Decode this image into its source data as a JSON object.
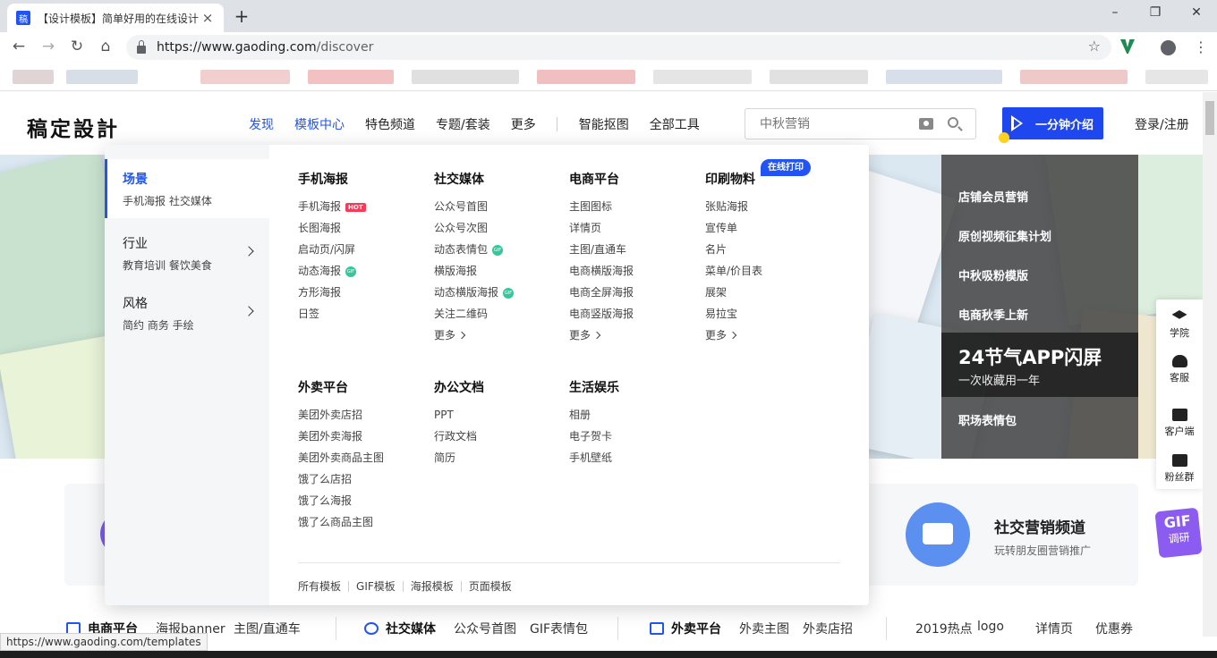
{
  "browser": {
    "tab_title": "【设计模板】简单好用的在线设计",
    "tab_close": "×",
    "new_tab": "+",
    "url_host": "https://www.gaoding.com",
    "url_path": "/discover",
    "favicon_text": "稿",
    "window_controls": [
      "–",
      "❐",
      "✕"
    ],
    "nav_icons": [
      "←",
      "→",
      "↻",
      "⌂"
    ],
    "star_icon": "☆",
    "menu_icon": "⋮"
  },
  "header": {
    "logo": "稿定設計",
    "nav": [
      "发现",
      "模板中心",
      "特色频道",
      "专题/套装",
      "更多"
    ],
    "nav_right": [
      "智能抠图",
      "全部工具"
    ],
    "search_placeholder": "中秋营销",
    "intro_button": "一分钟介绍",
    "login": "登录/注册"
  },
  "banner": {
    "side_items": [
      "店铺会员营销",
      "原创视频征集计划",
      "中秋吸粉模版",
      "电商秋季上新"
    ],
    "highlight_title": "24节气APP闪屏",
    "highlight_sub": "一次收藏用一年",
    "last_item": "职场表情包"
  },
  "mega_menu": {
    "left": [
      {
        "title": "场景",
        "sub": "手机海报 社交媒体"
      },
      {
        "title": "行业",
        "sub": "教育培训 餐饮美食"
      },
      {
        "title": "风格",
        "sub": "简约 商务 手绘"
      }
    ],
    "print_badge": "在线打印",
    "columns": [
      {
        "title": "手机海报",
        "items": [
          "手机海报",
          "长图海报",
          "启动页/闪屏",
          "动态海报",
          "方形海报",
          "日签"
        ]
      },
      {
        "title": "社交媒体",
        "items": [
          "公众号首图",
          "公众号次图",
          "动态表情包",
          "横版海报",
          "动态横版海报",
          "关注二维码"
        ],
        "more": "更多"
      },
      {
        "title": "电商平台",
        "items": [
          "主图图标",
          "详情页",
          "主图/直通车",
          "电商横版海报",
          "电商全屏海报",
          "电商竖版海报"
        ],
        "more": "更多"
      },
      {
        "title": "印刷物料",
        "items": [
          "张贴海报",
          "宣传单",
          "名片",
          "菜单/价目表",
          "展架",
          "易拉宝"
        ],
        "more": "更多"
      },
      {
        "title": "外卖平台",
        "items": [
          "美团外卖店招",
          "美团外卖海报",
          "美团外卖商品主图",
          "饿了么店招",
          "饿了么海报",
          "饿了么商品主图"
        ]
      },
      {
        "title": "办公文档",
        "items": [
          "PPT",
          "行政文档",
          "简历"
        ]
      },
      {
        "title": "生活娱乐",
        "items": [
          "相册",
          "电子贺卡",
          "手机壁纸"
        ]
      }
    ],
    "tags": {
      "hot": "HOT",
      "gif": "GIF"
    },
    "footer": [
      "所有模板",
      "GIF模板",
      "海报模板",
      "页面模板"
    ]
  },
  "social_card": {
    "title": "社交营销频道",
    "sub": "玩转朋友圈营销推广"
  },
  "gif_badge": {
    "line1": "GIF",
    "line2": "调研"
  },
  "side_tools": [
    "学院",
    "客服",
    "客户端",
    "粉丝群"
  ],
  "category_row": {
    "ecommerce": "电商平台",
    "ecommerce_items": [
      "海报banner",
      "主图/直通车"
    ],
    "social": "社交媒体",
    "social_items": [
      "公众号首图",
      "GIF表情包"
    ],
    "takeout": "外卖平台",
    "takeout_items": [
      "外卖主图",
      "外卖店招"
    ],
    "hot_items": [
      "2019热点",
      "logo",
      "详情页",
      "优惠券"
    ]
  },
  "status_url": "https://www.gaoding.com/templates",
  "colors": {
    "brand_blue": "#2254f4",
    "hot_red": "#ef3d5b",
    "gif_green": "#35c79b"
  }
}
